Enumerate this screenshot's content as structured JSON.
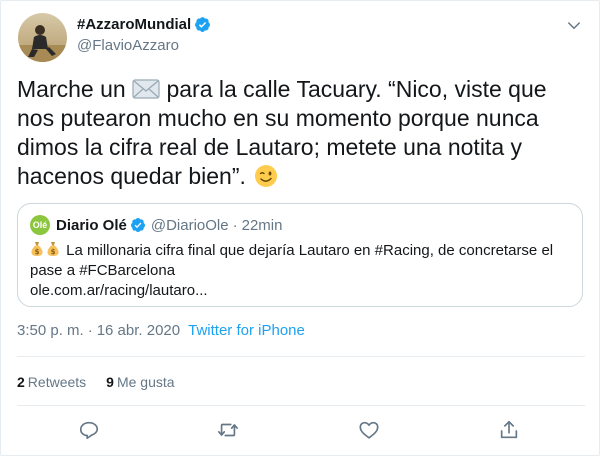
{
  "tweet": {
    "author": {
      "display_name": "#AzzaroMundial",
      "handle": "@FlavioAzzaro",
      "avatar_icon": "avatar-photo",
      "verified": true
    },
    "text": {
      "part1": "Marche un ",
      "part2": " para la calle Tacuary. “Nico, viste que nos putearon mucho en su momento porque nunca dimos la cifra real de Lautaro; metete una notita y hacenos quedar bien”. ",
      "emoji1": "envelope-icon",
      "emoji2": "winking-face-icon"
    },
    "quote": {
      "avatar_text": "Olé",
      "name": "Diario Olé",
      "handle": "@DiarioOle",
      "separator": "·",
      "time": "22min",
      "text": " La millonaria cifra final que dejaría Lautaro en #Racing, de concretarse el pase a #FCBarcelona",
      "link": "ole.com.ar/racing/lautaro..."
    },
    "meta": {
      "time": "3:50 p. m.",
      "separator": "·",
      "date": "16 abr. 2020",
      "source": "Twitter for iPhone"
    },
    "stats": {
      "retweets_count": "2",
      "retweets_label": "Retweets",
      "likes_count": "9",
      "likes_label": "Me gusta"
    },
    "actions": [
      "reply-icon",
      "retweet-icon",
      "like-icon",
      "share-icon"
    ]
  },
  "colors": {
    "accent": "#1da1f2",
    "text": "#14171a",
    "muted": "#657786",
    "border": "#e6ecf0",
    "quote_avatar": "#8cc63f"
  }
}
